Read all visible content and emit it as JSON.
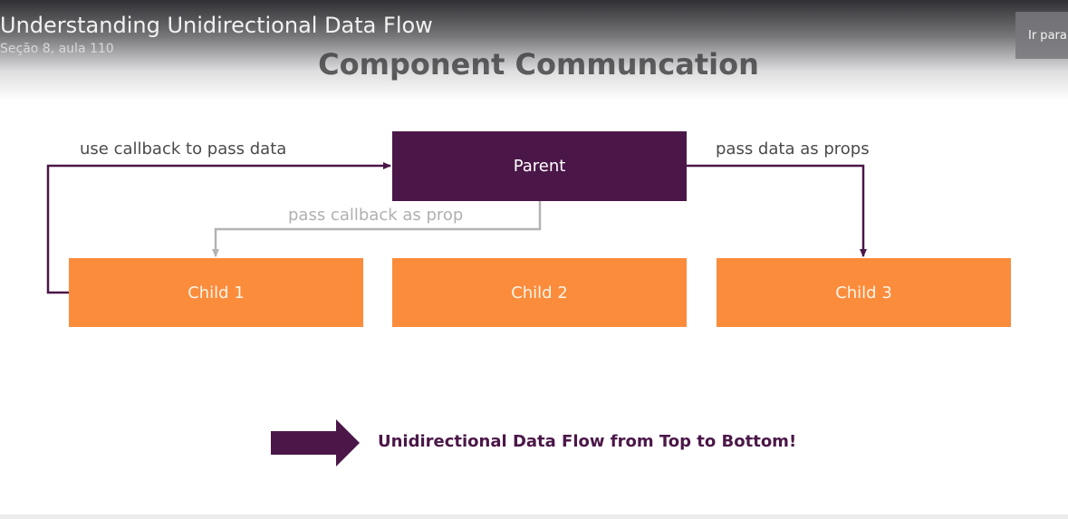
{
  "player": {
    "lecture_title": "Understanding Unidirectional Data Flow",
    "lecture_subtitle": "Seção 8, aula 110",
    "goto_button": "Ir para"
  },
  "slide": {
    "title": "Component Communcation",
    "parent": "Parent",
    "children": [
      "Child 1",
      "Child 2",
      "Child 3"
    ],
    "labels": {
      "callback_up": "use callback to pass data",
      "props_down": "pass data as props",
      "callback_as_prop": "pass callback as prop"
    },
    "footer_text": "Unidirectional Data Flow from Top to Bottom!"
  },
  "colors": {
    "parent": "#4b1748",
    "child": "#fa8c3c",
    "connector": "#4b1748",
    "connector_light": "#b3b3b3"
  }
}
